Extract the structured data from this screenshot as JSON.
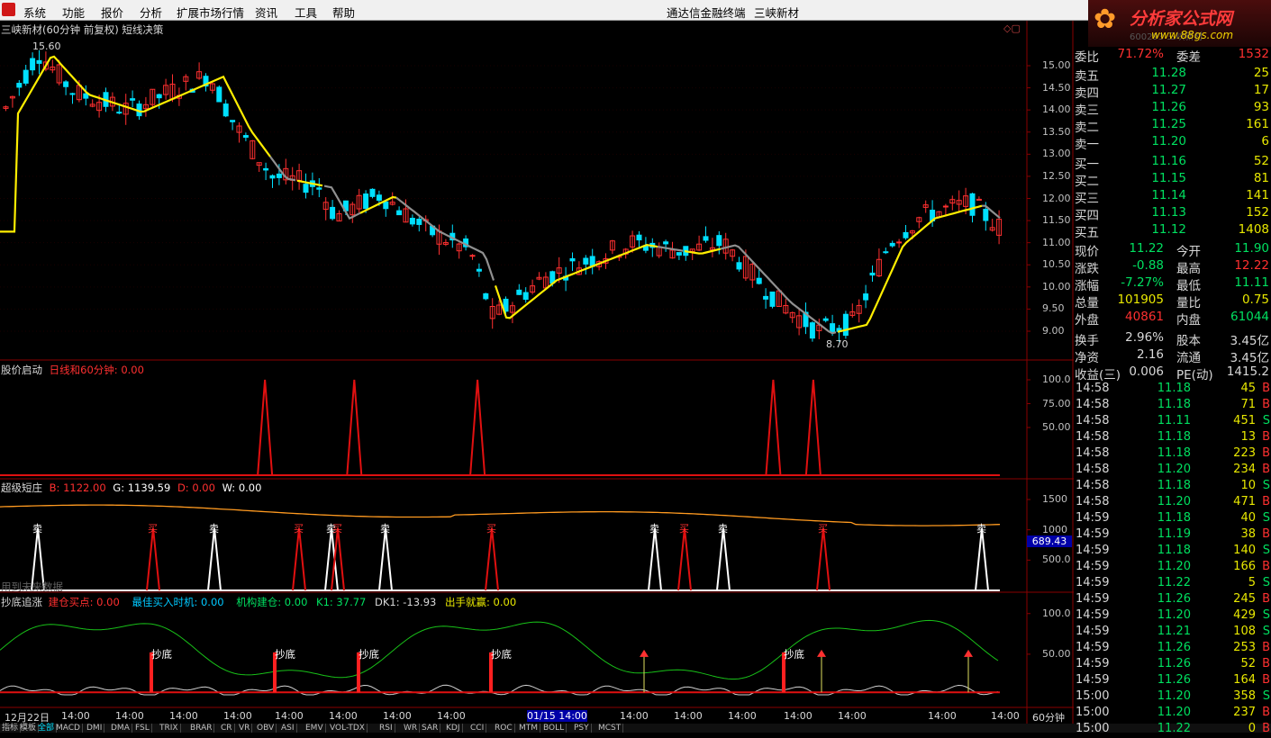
{
  "menu": {
    "items": [
      "系统",
      "功能",
      "报价",
      "分析",
      "扩展市场行情",
      "资讯",
      "工具",
      "帮助"
    ],
    "center_title": "通达信金融终端",
    "stock_name": "三峡新材"
  },
  "brand": {
    "name": "分析家公式网",
    "url": "www.88gs.com",
    "sub": "600293 三峡新材"
  },
  "colors": {
    "up": "#ff3030",
    "down": "#00e0ff",
    "yellow": "#ffee00",
    "gray": "#909090",
    "green": "#00e060",
    "axis": "#8a0000"
  },
  "main_chart": {
    "title": "三峡新材(60分钟 前复权) 短线决策",
    "high_label": "15.60",
    "low_label": "8.70",
    "y_ticks": [
      "15.00",
      "14.50",
      "14.00",
      "13.50",
      "13.00",
      "12.50",
      "12.00",
      "11.50",
      "11.00",
      "10.50",
      "10.00",
      "9.50",
      "9.00"
    ]
  },
  "ind1": {
    "name": "股价启动",
    "param": "日线和60分钟: 0.00",
    "y_ticks": [
      "100.0",
      "75.00",
      "50.00"
    ],
    "spikes": [
      0.258,
      0.345,
      0.465,
      0.753,
      0.792
    ]
  },
  "ind2": {
    "name": "超级短庄",
    "b": "B: 1122.00",
    "g": "G: 1139.59",
    "d": "D: 0.00",
    "w": "W: 0.00",
    "y_ticks": [
      "1500",
      "1000",
      "500.0"
    ],
    "cursor_value": "689.43",
    "sell_label": "卖",
    "buy_label": "买",
    "watermark": "用到未来数据"
  },
  "ind3": {
    "name": "抄底追涨",
    "f1": "建仓买点: 0.00",
    "f2": "最佳买入时机: 0.00",
    "f3": "机构建仓: 0.00",
    "f4": "K1: 37.77",
    "f5": "DK1: -13.93",
    "f6": "出手就赢: 0.00",
    "y_ticks": [
      "100.0",
      "50.00"
    ],
    "marker": "抄底"
  },
  "x_axis": {
    "labels": [
      "12月22日",
      "14:00",
      "14:00",
      "14:00",
      "14:00",
      "14:00",
      "14:00",
      "14:00",
      "14:00",
      "01/15 14:00",
      "14:00",
      "14:00",
      "14:00",
      "14:00",
      "14:00",
      "14:00",
      "14:00"
    ],
    "period": "60分钟"
  },
  "quote": {
    "weibi_label": "委比",
    "weibi": "71.72%",
    "weicha_label": "委差",
    "weicha": "1532",
    "sell": [
      {
        "l": "卖五",
        "p": "11.28",
        "q": "25"
      },
      {
        "l": "卖四",
        "p": "11.27",
        "q": "17"
      },
      {
        "l": "卖三",
        "p": "11.26",
        "q": "93"
      },
      {
        "l": "卖二",
        "p": "11.25",
        "q": "161"
      },
      {
        "l": "卖一",
        "p": "11.20",
        "q": "6"
      }
    ],
    "buy": [
      {
        "l": "买一",
        "p": "11.16",
        "q": "52"
      },
      {
        "l": "买二",
        "p": "11.15",
        "q": "81"
      },
      {
        "l": "买三",
        "p": "11.14",
        "q": "141"
      },
      {
        "l": "买四",
        "p": "11.13",
        "q": "152"
      },
      {
        "l": "买五",
        "p": "11.12",
        "q": "1408"
      }
    ],
    "stats": [
      {
        "l": "现价",
        "v": "11.22",
        "c": "#00e060",
        "l2": "今开",
        "v2": "11.90",
        "c2": "#00e060"
      },
      {
        "l": "涨跌",
        "v": "-0.88",
        "c": "#00e060",
        "l2": "最高",
        "v2": "12.22",
        "c2": "#ff3030"
      },
      {
        "l": "涨幅",
        "v": "-7.27%",
        "c": "#00e060",
        "l2": "最低",
        "v2": "11.11",
        "c2": "#00e060"
      },
      {
        "l": "总量",
        "v": "101905",
        "c": "#e8e800",
        "l2": "量比",
        "v2": "0.75",
        "c2": "#e8e800"
      },
      {
        "l": "外盘",
        "v": "40861",
        "c": "#ff3030",
        "l2": "内盘",
        "v2": "61044",
        "c2": "#00e060"
      }
    ],
    "fund": [
      {
        "l": "换手",
        "v": "2.96%",
        "l2": "股本",
        "v2": "3.45亿"
      },
      {
        "l": "净资",
        "v": "2.16",
        "l2": "流通",
        "v2": "3.45亿"
      },
      {
        "l": "收益(三)",
        "v": "0.006",
        "l2": "PE(动)",
        "v2": "1415.2"
      }
    ],
    "ticks": [
      {
        "t": "14:58",
        "p": "11.18",
        "q": "45",
        "f": "B"
      },
      {
        "t": "14:58",
        "p": "11.18",
        "q": "71",
        "f": "B"
      },
      {
        "t": "14:58",
        "p": "11.11",
        "q": "451",
        "f": "S"
      },
      {
        "t": "14:58",
        "p": "11.18",
        "q": "13",
        "f": "B"
      },
      {
        "t": "14:58",
        "p": "11.18",
        "q": "223",
        "f": "B"
      },
      {
        "t": "14:58",
        "p": "11.20",
        "q": "234",
        "f": "B"
      },
      {
        "t": "14:58",
        "p": "11.18",
        "q": "10",
        "f": "S"
      },
      {
        "t": "14:58",
        "p": "11.20",
        "q": "471",
        "f": "B"
      },
      {
        "t": "14:59",
        "p": "11.18",
        "q": "40",
        "f": "S"
      },
      {
        "t": "14:59",
        "p": "11.19",
        "q": "38",
        "f": "B"
      },
      {
        "t": "14:59",
        "p": "11.18",
        "q": "140",
        "f": "S"
      },
      {
        "t": "14:59",
        "p": "11.20",
        "q": "166",
        "f": "B"
      },
      {
        "t": "14:59",
        "p": "11.22",
        "q": "5",
        "f": "S"
      },
      {
        "t": "14:59",
        "p": "11.26",
        "q": "245",
        "f": "B"
      },
      {
        "t": "14:59",
        "p": "11.20",
        "q": "429",
        "f": "S"
      },
      {
        "t": "14:59",
        "p": "11.21",
        "q": "108",
        "f": "S"
      },
      {
        "t": "14:59",
        "p": "11.26",
        "q": "253",
        "f": "B"
      },
      {
        "t": "14:59",
        "p": "11.26",
        "q": "52",
        "f": "B"
      },
      {
        "t": "14:59",
        "p": "11.26",
        "q": "164",
        "f": "B"
      },
      {
        "t": "15:00",
        "p": "11.20",
        "q": "358",
        "f": "S"
      },
      {
        "t": "15:00",
        "p": "11.20",
        "q": "237",
        "f": "B"
      },
      {
        "t": "15:00",
        "p": "11.22",
        "q": "0",
        "f": "B"
      }
    ]
  },
  "tabs": [
    "指标",
    "模板",
    "全部",
    "MACD",
    "DMI",
    "DMA",
    "FSL",
    "TRIX",
    "BRAR",
    "CR",
    "VR",
    "OBV",
    "ASI",
    "EMV",
    "VOL-TDX",
    "RSI",
    "WR",
    "SAR",
    "KDJ",
    "CCI",
    "ROC",
    "MTM",
    "BOLL",
    "PSY",
    "MCST"
  ]
}
